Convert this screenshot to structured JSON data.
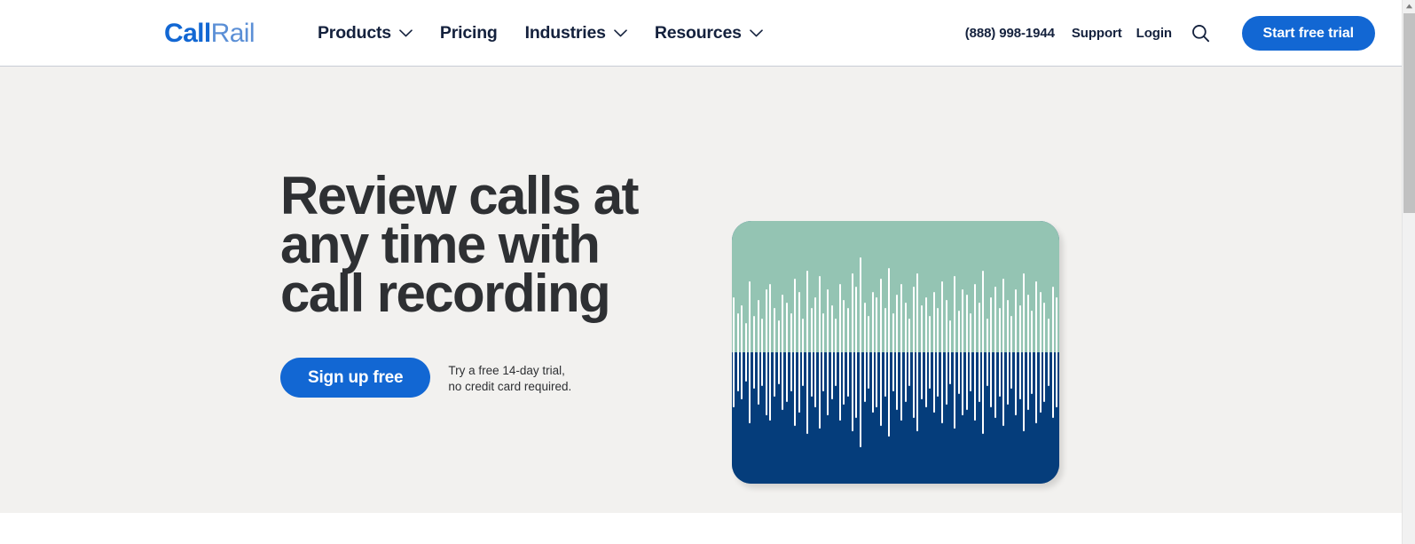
{
  "page": {
    "background_color": "#f2f1ef",
    "accent_color": "#1267d3",
    "text_color": "#14213d"
  },
  "header": {
    "logo": {
      "part1": "Call",
      "part2": "Rail"
    },
    "nav": [
      {
        "label": "Products",
        "icon": "chevron-down-icon",
        "has_dropdown": true
      },
      {
        "label": "Pricing",
        "has_dropdown": false
      },
      {
        "label": "Industries",
        "icon": "chevron-down-icon",
        "has_dropdown": true
      },
      {
        "label": "Resources",
        "icon": "chevron-down-icon",
        "has_dropdown": true
      }
    ],
    "utility": {
      "phone": "(888) 998-1944",
      "support": "Support",
      "login": "Login",
      "search_icon": "search-icon"
    },
    "cta": {
      "label": "Start free trial"
    }
  },
  "hero": {
    "title": "Review calls at\nany time with\ncall recording",
    "cta": {
      "label": "Sign up free"
    },
    "note": "Try a free 14-day trial,\nno credit card required.",
    "media": {
      "type": "call-recording-waveform",
      "top_color": "#94c4b3",
      "bottom_color": "#053d7b",
      "bar_color": "#ffffff",
      "bar_heights_pct": [
        42,
        30,
        36,
        22,
        54,
        28,
        40,
        26,
        48,
        52,
        34,
        24,
        44,
        38,
        30,
        56,
        46,
        26,
        62,
        34,
        42,
        58,
        30,
        48,
        36,
        26,
        52,
        40,
        34,
        60,
        50,
        72,
        38,
        28,
        46,
        42,
        56,
        34,
        64,
        30,
        44,
        52,
        38,
        26,
        50,
        60,
        36,
        42,
        28,
        46,
        34,
        54,
        40,
        24,
        58,
        32,
        48,
        44,
        30,
        52,
        38,
        62,
        26,
        42,
        50,
        34,
        56,
        40,
        28,
        48,
        36,
        60,
        44,
        32,
        54,
        46,
        38,
        26,
        50,
        42
      ]
    }
  },
  "scrollbar": {
    "up_arrow_icon": "scroll-up-arrow-icon",
    "thumb_position": "top"
  }
}
